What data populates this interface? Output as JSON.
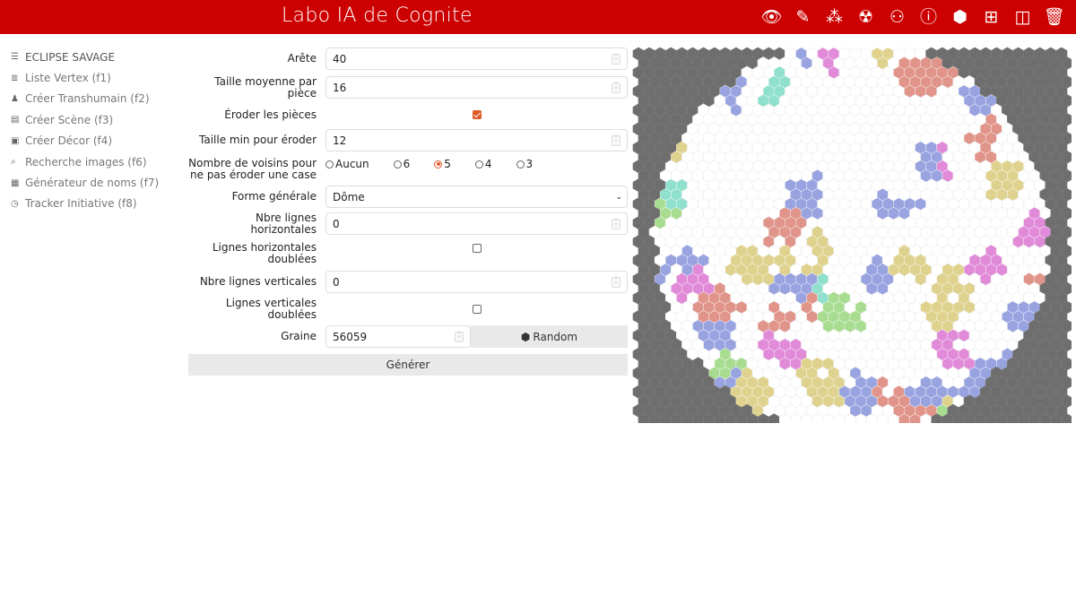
{
  "header": {
    "title": "Labo IA de Cognite",
    "icons": [
      "eye-icon",
      "edit-icon",
      "network-icon",
      "radiation-icon",
      "people-hierarchy-icon",
      "info-icon",
      "cube-rotate-icon",
      "tree-add-icon",
      "split-icon",
      "trash-icon"
    ]
  },
  "sidebar": {
    "items": [
      {
        "icon": "bars-icon",
        "label": "ECLIPSE SAVAGE"
      },
      {
        "icon": "list-icon",
        "label": "Liste Vertex (f1)"
      },
      {
        "icon": "user-plus-icon",
        "label": "Créer Transhumain (f2)"
      },
      {
        "icon": "film-icon",
        "label": "Créer Scène (f3)"
      },
      {
        "icon": "image-icon",
        "label": "Créer Décor (f4)"
      },
      {
        "icon": "search-icon",
        "label": "Recherche images (f6)"
      },
      {
        "icon": "id-card-icon",
        "label": "Générateur de noms (f7)"
      },
      {
        "icon": "stopwatch-icon",
        "label": "Tracker Initiative (f8)"
      }
    ]
  },
  "form": {
    "arete": {
      "label": "Arête",
      "value": "40"
    },
    "taille": {
      "label": "Taille moyenne par pièce",
      "value": "16"
    },
    "eroder": {
      "label": "Éroder les pièces",
      "checked": true
    },
    "taille_min": {
      "label": "Taille min pour éroder",
      "value": "12"
    },
    "voisins": {
      "label": "Nombre de voisins pour ne pas éroder une case",
      "options": [
        "Aucun",
        "6",
        "5",
        "4",
        "3"
      ],
      "selected": "5"
    },
    "forme": {
      "label": "Forme générale",
      "value": "Dôme"
    },
    "nb_h": {
      "label": "Nbre lignes horizontales",
      "value": "0"
    },
    "h_double": {
      "label": "Lignes horizontales doublées",
      "checked": false
    },
    "nb_v": {
      "label": "Nbre lignes verticales",
      "value": "0"
    },
    "v_double": {
      "label": "Lignes verticales doublées",
      "checked": false
    },
    "graine": {
      "label": "Graine",
      "value": "56059"
    },
    "random_label": "Random",
    "generate_label": "Générer"
  },
  "map": {
    "colors": {
      "outside": "#6e6e6e",
      "empty": "#ffffff",
      "pieces": [
        "#98a3e0",
        "#dfd28e",
        "#e08ad8",
        "#e0948a",
        "#a8dc90",
        "#8fe0cc"
      ]
    }
  }
}
